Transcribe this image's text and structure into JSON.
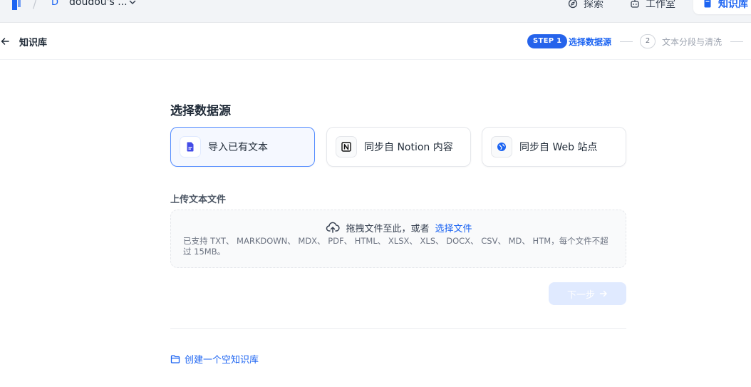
{
  "topnav": {
    "workspace_initial": "D",
    "workspace_name": "doudou's ...",
    "explore_label": "探索",
    "studio_label": "工作室",
    "knowledge_label": "知识库"
  },
  "subheader": {
    "title": "知识库",
    "steps": [
      {
        "badge": "STEP 1",
        "label": "选择数据源",
        "state": "active"
      },
      {
        "badge": "2",
        "label": "文本分段与清洗",
        "state": "inactive"
      }
    ]
  },
  "datasource": {
    "title": "选择数据源",
    "options": [
      {
        "label": "导入已有文本",
        "icon": "file-text-icon",
        "selected": true
      },
      {
        "label": "同步自 Notion 内容",
        "icon": "notion-icon",
        "selected": false
      },
      {
        "label": "同步自 Web 站点",
        "icon": "globe-icon",
        "selected": false
      }
    ]
  },
  "upload": {
    "title": "上传文本文件",
    "drop_text": "拖拽文件至此，或者",
    "select_link": "选择文件",
    "supported_note": "已支持 TXT、 MARKDOWN、 MDX、 PDF、 HTML、 XLSX、 XLS、 DOCX、 CSV、 MD、 HTM，每个文件不超过 15MB。"
  },
  "next_button": {
    "label": "下一步",
    "disabled": true
  },
  "empty_kb_link": "创建一个空知识库",
  "colors": {
    "accent": "#1c64f2",
    "selected_border": "#528bff",
    "disabled_button": "#e0eaff"
  }
}
